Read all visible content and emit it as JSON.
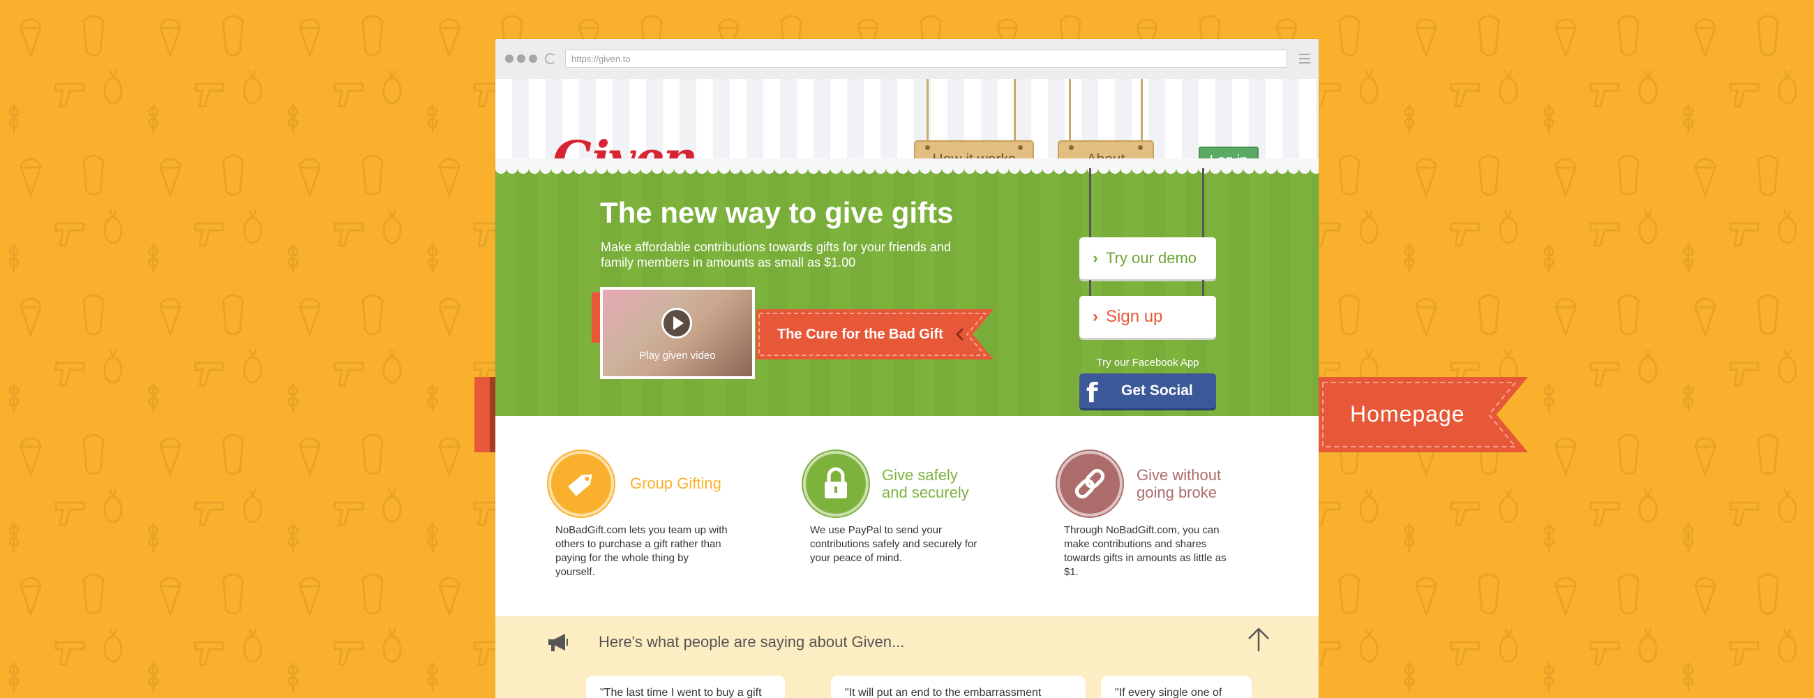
{
  "browser": {
    "url": "https://given.to"
  },
  "header": {
    "logo_text": "Given",
    "nav": [
      {
        "label": "How it works"
      },
      {
        "label": "About"
      }
    ],
    "login_label": "Log in"
  },
  "hero": {
    "title": "The new way to give gifts",
    "subtitle": "Make affordable contributions towards gifts for your friends and family members in amounts as small as $1.00",
    "video_label": "Play given video",
    "ribbon_text": "The Cure for the Bad Gift",
    "demo_label": "Try our demo",
    "signup_label": "Sign up",
    "facebook_caption": "Try our Facebook App",
    "facebook_button": "Get Social"
  },
  "features": [
    {
      "title_line1": "Group Gifting",
      "title_line2": "",
      "icon": "tag-icon",
      "color": "#F9B12D",
      "description": "NoBadGift.com lets you team up with others to purchase a gift rather than paying for the whole thing by yourself."
    },
    {
      "title_line1": "Give safely",
      "title_line2": "and securely",
      "icon": "lock-icon",
      "color": "#7DB23D",
      "description": "We use PayPal to send your contributions safely and securely for your peace of mind."
    },
    {
      "title_line1": "Give without",
      "title_line2": "going broke",
      "icon": "link-icon",
      "color": "#AD6C6C",
      "description": "Through NoBadGift.com, you can make contributions and shares towards gifts in amounts as little as $1."
    }
  ],
  "testimonials": {
    "heading": "Here's what people are saying about Given...",
    "quotes": [
      "\"The last time I went to buy a gift",
      "\"It will put an end to the embarrassment",
      "\"If every single one of"
    ]
  },
  "banner": {
    "label": "Homepage"
  },
  "colors": {
    "background": "#F9B12D",
    "hero_green": "#7DB23D",
    "accent_red": "#E65837",
    "logo_red": "#D72433",
    "facebook_blue": "#3B5998"
  }
}
